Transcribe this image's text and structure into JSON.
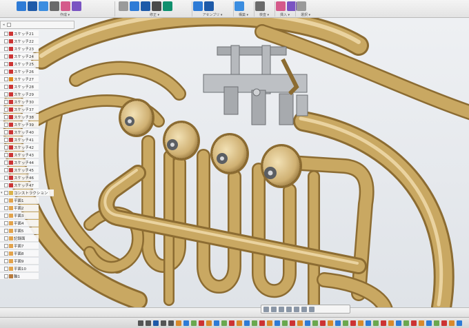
{
  "toolbar": {
    "groups": [
      {
        "label": "作成 ▾",
        "icons": [
          "new-sketch-icon",
          "box-icon",
          "extrude-icon",
          "revolve-icon",
          "pattern-icon",
          "form-icon"
        ]
      },
      {
        "label": "修正 ▾",
        "icons": [
          "press-pull-icon",
          "fillet-icon",
          "chamfer-icon",
          "shell-icon",
          "move-icon"
        ]
      },
      {
        "label": "アセンブリ ▾",
        "icons": [
          "joint-icon",
          "as-built-joint-icon"
        ]
      },
      {
        "label": "構築 ▾",
        "icons": [
          "offset-plane-icon"
        ]
      },
      {
        "label": "検査 ▾",
        "icons": [
          "measure-icon"
        ]
      },
      {
        "label": "挿入 ▾",
        "icons": [
          "insert-icon",
          "decal-icon"
        ]
      },
      {
        "label": "選択 ▾",
        "icons": [
          "select-icon"
        ]
      }
    ]
  },
  "browser": {
    "items": [
      {
        "label": "スケッチ21",
        "kind": "sketch"
      },
      {
        "label": "スケッチ22",
        "kind": "sketch"
      },
      {
        "label": "スケッチ23",
        "kind": "sketch"
      },
      {
        "label": "スケッチ24",
        "kind": "sketch"
      },
      {
        "label": "スケッチ25",
        "kind": "sketch"
      },
      {
        "label": "スケッチ26",
        "kind": "sketch"
      },
      {
        "label": "スケッチ27",
        "kind": "sketch-warn"
      },
      {
        "label": "スケッチ28",
        "kind": "sketch"
      },
      {
        "label": "スケッチ29",
        "kind": "sketch"
      },
      {
        "label": "スケッチ30",
        "kind": "sketch"
      },
      {
        "label": "スケッチ37",
        "kind": "sketch"
      },
      {
        "label": "スケッチ38",
        "kind": "sketch"
      },
      {
        "label": "スケッチ39",
        "kind": "sketch"
      },
      {
        "label": "スケッチ40",
        "kind": "sketch"
      },
      {
        "label": "スケッチ41",
        "kind": "sketch"
      },
      {
        "label": "スケッチ42",
        "kind": "sketch"
      },
      {
        "label": "スケッチ43",
        "kind": "sketch"
      },
      {
        "label": "スケッチ44",
        "kind": "sketch"
      },
      {
        "label": "スケッチ45",
        "kind": "sketch"
      },
      {
        "label": "スケッチ46",
        "kind": "sketch"
      },
      {
        "label": "スケッチ47",
        "kind": "sketch"
      },
      {
        "label": "コンストラクション",
        "kind": "folder"
      },
      {
        "label": "平面1",
        "kind": "plane"
      },
      {
        "label": "平面2",
        "kind": "plane"
      },
      {
        "label": "平面3",
        "kind": "plane"
      },
      {
        "label": "平面4",
        "kind": "plane"
      },
      {
        "label": "平面5",
        "kind": "plane"
      },
      {
        "label": "記録面",
        "kind": "plane"
      },
      {
        "label": "平面7",
        "kind": "plane"
      },
      {
        "label": "平面8",
        "kind": "plane"
      },
      {
        "label": "平面9",
        "kind": "plane"
      },
      {
        "label": "平面10",
        "kind": "plane"
      },
      {
        "label": "軸1",
        "kind": "axis"
      }
    ]
  },
  "nav_bar": {
    "icons": [
      "orbit-icon",
      "pan-icon",
      "zoom-icon",
      "fit-icon",
      "display-settings-icon",
      "grid-icon",
      "viewports-icon"
    ]
  },
  "timeline": {
    "icons": [
      "first-icon",
      "prev-icon",
      "play-icon",
      "next-icon",
      "last-icon"
    ]
  },
  "colors": {
    "brass": "#c9a862",
    "brass_dark": "#8c6c32",
    "brass_light": "#ead3a0",
    "steel": "#a7aaae",
    "accent": "#1e5aa8"
  }
}
